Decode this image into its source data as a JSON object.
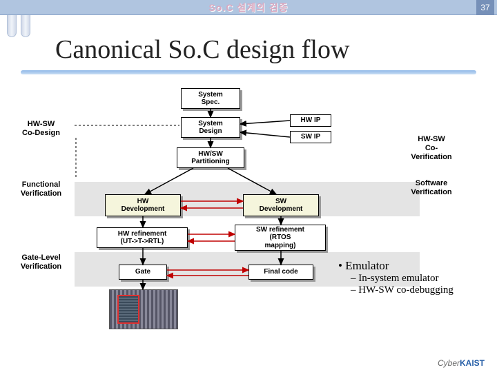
{
  "header": {
    "title": "So.C 설계의 검증",
    "page": "37"
  },
  "slide": {
    "title": "Canonical So.C design flow"
  },
  "left_labels": {
    "codesign": "HW-SW\nCo-Design",
    "funcver": "Functional\nVerification",
    "gatever": "Gate-Level\nVerification"
  },
  "right_labels": {
    "cover": "HW-SW\nCo-\nVerification",
    "swver": "Software\nVerification"
  },
  "boxes": {
    "spec": "System\nSpec.",
    "design": "System\nDesign",
    "partition": "HW/SW\nPartitioning",
    "hwdev": "HW\nDevelopment",
    "swdev": "SW\nDevelopment",
    "hwref": "HW refinement\n(UT->T->RTL)",
    "swref": "SW refinement\n(RTOS\nmapping)",
    "gate": "Gate",
    "final": "Final code",
    "hwip": "HW IP",
    "swip": "SW IP"
  },
  "bullets": {
    "b1": "Emulator",
    "b2a": "In-system emulator",
    "b2b": "HW-SW co-debugging"
  },
  "logo": {
    "prefix": "Cyber",
    "suffix": "KAIST"
  }
}
